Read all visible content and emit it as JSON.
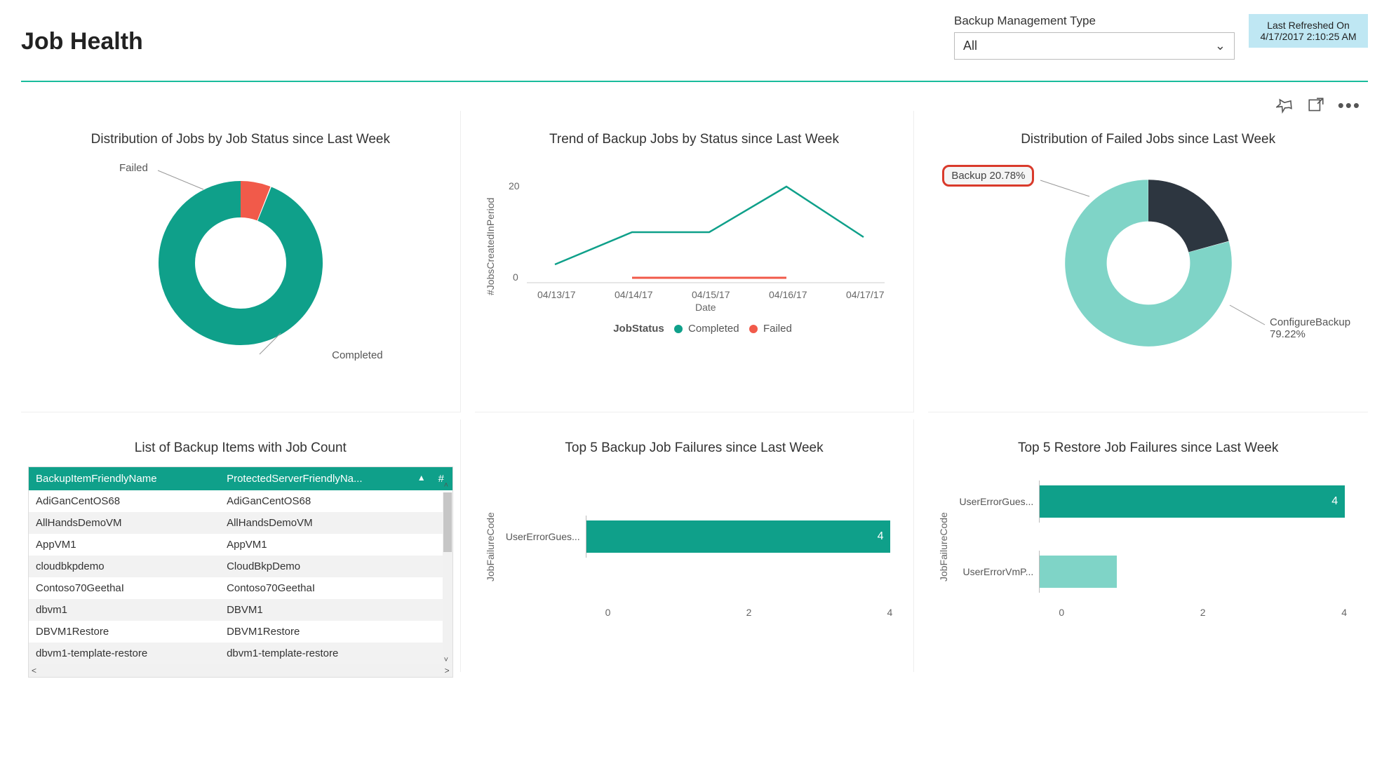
{
  "header": {
    "title": "Job Health",
    "filter_label": "Backup Management Type",
    "filter_value": "All",
    "refresh_label": "Last Refreshed On",
    "refresh_time": "4/17/2017 2:10:25 AM"
  },
  "toolbar_icons": {
    "pin": "pin-icon",
    "focus": "focus-mode-icon",
    "more": "more-options-icon"
  },
  "panel1": {
    "title": "Distribution of Jobs by Job Status since Last Week",
    "labels": {
      "failed": "Failed",
      "completed": "Completed"
    }
  },
  "panel2": {
    "title": "Trend of Backup Jobs by Status since Last Week",
    "ylabel": "#JobsCreatedInPeriod",
    "xlabel": "Date",
    "legend_title": "JobStatus",
    "legend_completed": "Completed",
    "legend_failed": "Failed",
    "xticks": [
      "04/13/17",
      "04/14/17",
      "04/15/17",
      "04/16/17",
      "04/17/17"
    ],
    "yticks": [
      "0",
      "20"
    ]
  },
  "panel3": {
    "title": "Distribution of Failed Jobs since Last Week",
    "callout": "Backup 20.78%",
    "labels": {
      "configure": "ConfigureBackup",
      "configure_pct": "79.22%"
    }
  },
  "panel4": {
    "title": "List of Backup Items with Job Count",
    "columns": [
      "BackupItemFriendlyName",
      "ProtectedServerFriendlyNa...",
      "#"
    ],
    "rows": [
      [
        "AdiGanCentOS68",
        "AdiGanCentOS68"
      ],
      [
        "AllHandsDemoVM",
        "AllHandsDemoVM"
      ],
      [
        "AppVM1",
        "AppVM1"
      ],
      [
        "cloudbkpdemo",
        "CloudBkpDemo"
      ],
      [
        "Contoso70GeethaI",
        "Contoso70GeethaI"
      ],
      [
        "dbvm1",
        "DBVM1"
      ],
      [
        "DBVM1Restore",
        "DBVM1Restore"
      ],
      [
        "dbvm1-template-restore",
        "dbvm1-template-restore"
      ]
    ]
  },
  "panel5": {
    "title": "Top 5 Backup Job Failures since Last Week",
    "ylabel": "JobFailureCode",
    "xticks": [
      "0",
      "2",
      "4"
    ]
  },
  "panel6": {
    "title": "Top 5 Restore Job Failures since Last Week",
    "ylabel": "JobFailureCode",
    "xticks": [
      "0",
      "2",
      "4"
    ]
  },
  "chart_data": [
    {
      "id": "jobs_by_status_donut",
      "type": "pie",
      "title": "Distribution of Jobs by Job Status since Last Week",
      "series": [
        {
          "name": "Failed",
          "value_pct": 6
        },
        {
          "name": "Completed",
          "value_pct": 94
        }
      ]
    },
    {
      "id": "trend_backup_jobs_line",
      "type": "line",
      "title": "Trend of Backup Jobs by Status since Last Week",
      "xlabel": "Date",
      "ylabel": "#JobsCreatedInPeriod",
      "x": [
        "04/13/17",
        "04/14/17",
        "04/15/17",
        "04/16/17",
        "04/17/17"
      ],
      "series": [
        {
          "name": "Completed",
          "color": "#0fa08a",
          "values": [
            4,
            11,
            11,
            21,
            10
          ]
        },
        {
          "name": "Failed",
          "color": "#f15a4a",
          "values": [
            0,
            1,
            1,
            1,
            0
          ]
        }
      ],
      "ylim": [
        0,
        22
      ]
    },
    {
      "id": "failed_jobs_distribution_donut",
      "type": "pie",
      "title": "Distribution of Failed Jobs since Last Week",
      "series": [
        {
          "name": "Backup",
          "value_pct": 20.78
        },
        {
          "name": "ConfigureBackup",
          "value_pct": 79.22
        }
      ]
    },
    {
      "id": "backup_items_table",
      "type": "table",
      "title": "List of Backup Items with Job Count",
      "columns": [
        "BackupItemFriendlyName",
        "ProtectedServerFriendlyName",
        "#"
      ],
      "rows": [
        [
          "AdiGanCentOS68",
          "AdiGanCentOS68",
          null
        ],
        [
          "AllHandsDemoVM",
          "AllHandsDemoVM",
          null
        ],
        [
          "AppVM1",
          "AppVM1",
          null
        ],
        [
          "cloudbkpdemo",
          "CloudBkpDemo",
          null
        ],
        [
          "Contoso70GeethaI",
          "Contoso70GeethaI",
          null
        ],
        [
          "dbvm1",
          "DBVM1",
          null
        ],
        [
          "DBVM1Restore",
          "DBVM1Restore",
          null
        ],
        [
          "dbvm1-template-restore",
          "dbvm1-template-restore",
          null
        ]
      ]
    },
    {
      "id": "top5_backup_failures_bar",
      "type": "bar",
      "orientation": "horizontal",
      "title": "Top 5 Backup Job Failures since Last Week",
      "ylabel": "JobFailureCode",
      "categories": [
        "UserErrorGues..."
      ],
      "values": [
        4
      ],
      "xlim": [
        0,
        4
      ]
    },
    {
      "id": "top5_restore_failures_bar",
      "type": "bar",
      "orientation": "horizontal",
      "title": "Top 5 Restore Job Failures since Last Week",
      "ylabel": "JobFailureCode",
      "categories": [
        "UserErrorGues...",
        "UserErrorVmP..."
      ],
      "values": [
        4,
        1
      ],
      "xlim": [
        0,
        4
      ]
    }
  ]
}
